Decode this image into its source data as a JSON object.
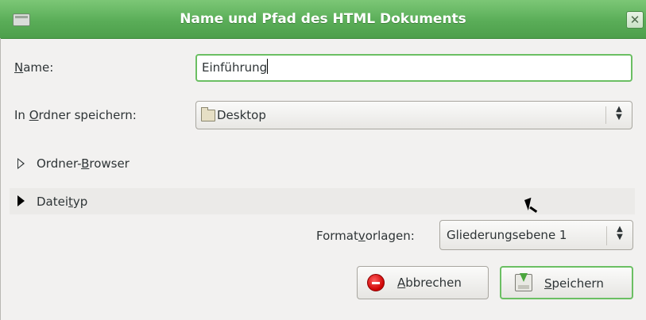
{
  "window": {
    "title": "Name und Pfad des HTML Dokuments",
    "close_glyph": "✕",
    "icons": {
      "window_menu": "window-menu-icon",
      "close": "close-icon"
    }
  },
  "name_field": {
    "label_mnemonic": "N",
    "label_rest": "ame:",
    "value": "Einführung"
  },
  "folder_field": {
    "label_pre": "In ",
    "label_mnemonic": "O",
    "label_rest": "rdner speichern:",
    "value": "Desktop",
    "icon": "desktop-folder-icon"
  },
  "folder_browser": {
    "label_pre": "Ordner-",
    "label_mnemonic": "B",
    "label_rest": "rowser",
    "expanded": false
  },
  "file_type": {
    "label_pre": "Datei",
    "label_mnemonic": "t",
    "label_rest": "yp",
    "expanded": false
  },
  "format_templates": {
    "label_pre": "Format",
    "label_mnemonic": "v",
    "label_rest": "orlagen:",
    "value": "Gliederungsebene 1"
  },
  "buttons": {
    "cancel": {
      "mnemonic": "A",
      "rest": "bbrechen",
      "icon": "stop-icon"
    },
    "save": {
      "mnemonic": "S",
      "rest": "peichern",
      "icon": "save-icon"
    }
  },
  "colors": {
    "titlebar": "#5aad58",
    "focus_border": "#6bbf63",
    "background": "#f2f1f0"
  }
}
